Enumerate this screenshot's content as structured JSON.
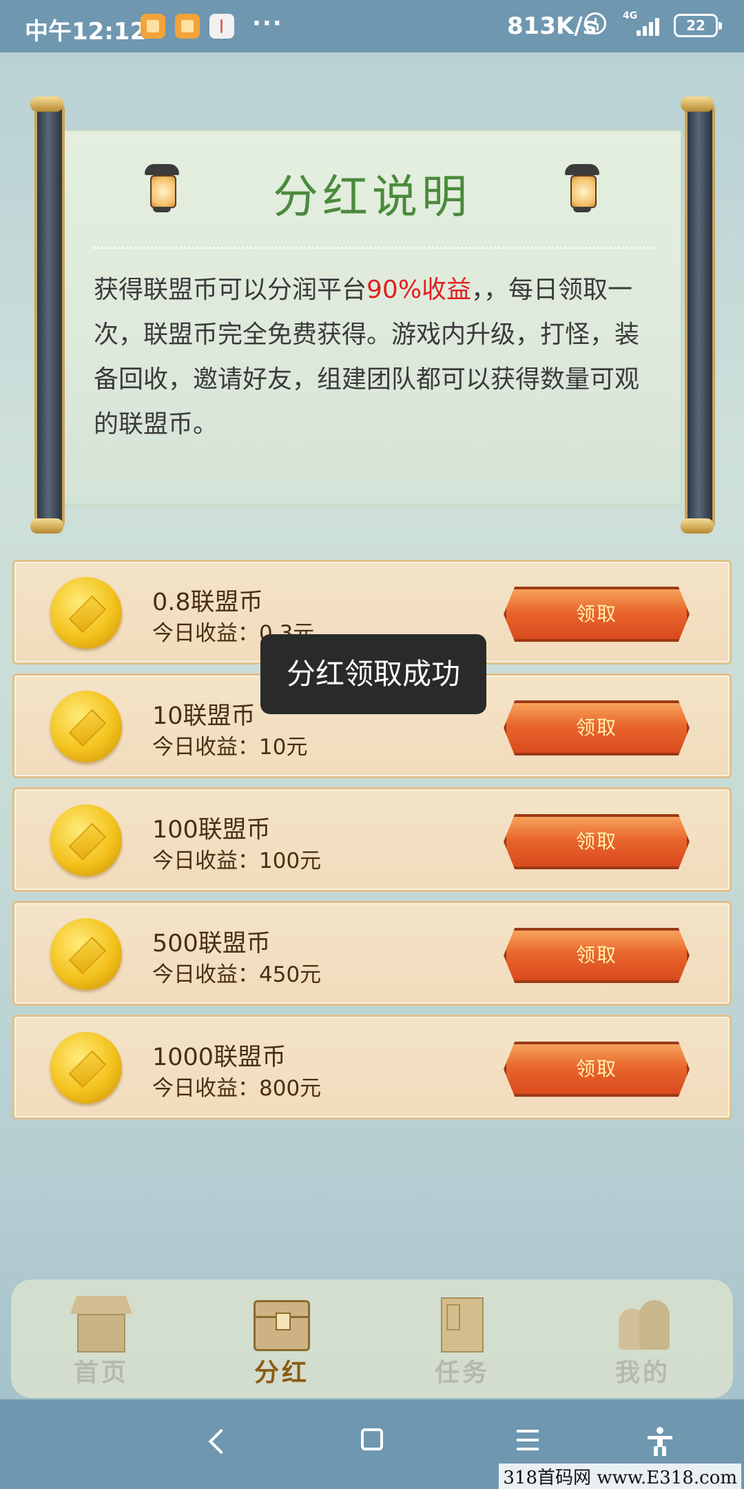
{
  "status_bar": {
    "time": "中午12:12",
    "more": "···",
    "net_speed": "813K/s",
    "network": "4G",
    "battery": "22"
  },
  "explanation": {
    "title": "分红说明",
    "text_before": "获得联盟币可以分润平台",
    "highlight": "90%收益",
    "text_after": "，，每日领取一次，联盟币完全免费获得。游戏内升级，打怪，装备回收，邀请好友，组建团队都可以获得数量可观的联盟币。",
    "highlight_color": "#e11f1f"
  },
  "rewards": [
    {
      "title": "0.8联盟币",
      "income": "今日收益：0.3元",
      "button": "领取"
    },
    {
      "title": "10联盟币",
      "income": "今日收益：10元",
      "button": "领取"
    },
    {
      "title": "100联盟币",
      "income": "今日收益：100元",
      "button": "领取"
    },
    {
      "title": "500联盟币",
      "income": "今日收益：450元",
      "button": "领取"
    },
    {
      "title": "1000联盟币",
      "income": "今日收益：800元",
      "button": "领取"
    }
  ],
  "toast": "分红领取成功",
  "tabs": [
    {
      "label": "首页",
      "icon": "house-icon",
      "active": false
    },
    {
      "label": "分红",
      "icon": "chest-icon",
      "active": true
    },
    {
      "label": "任务",
      "icon": "book-icon",
      "active": false
    },
    {
      "label": "我的",
      "icon": "people-icon",
      "active": false
    }
  ],
  "watermark": "318首码网 www.E318.com",
  "colors": {
    "title_green": "#4b8a3d",
    "button_orange": "#e9662c",
    "active_tab": "#8a5c12",
    "status_bar": "#6f97b0"
  }
}
